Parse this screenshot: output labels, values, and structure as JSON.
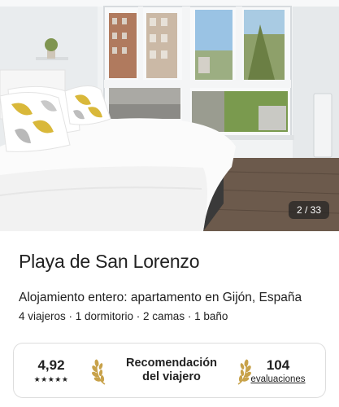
{
  "photo": {
    "alt": "Dormitorio con cama doble y ventanales",
    "counter": "2 / 33"
  },
  "listing": {
    "title": "Playa de San Lorenzo",
    "subtitle": "Alojamiento entero: apartamento en Gijón, España",
    "details": "4 viajeros · 1 dormitorio · 2 camas · 1 baño"
  },
  "highlights": {
    "rating": "4,92",
    "stars": "★★★★★",
    "rating_count": 5,
    "guest_favorite_line1": "Recomendación",
    "guest_favorite_line2": "del viajero",
    "reviews_count": "104",
    "reviews_label": "evaluaciones"
  },
  "colors": {
    "text": "#222222",
    "border": "#dddddd",
    "laurel": "#c8a24a"
  }
}
